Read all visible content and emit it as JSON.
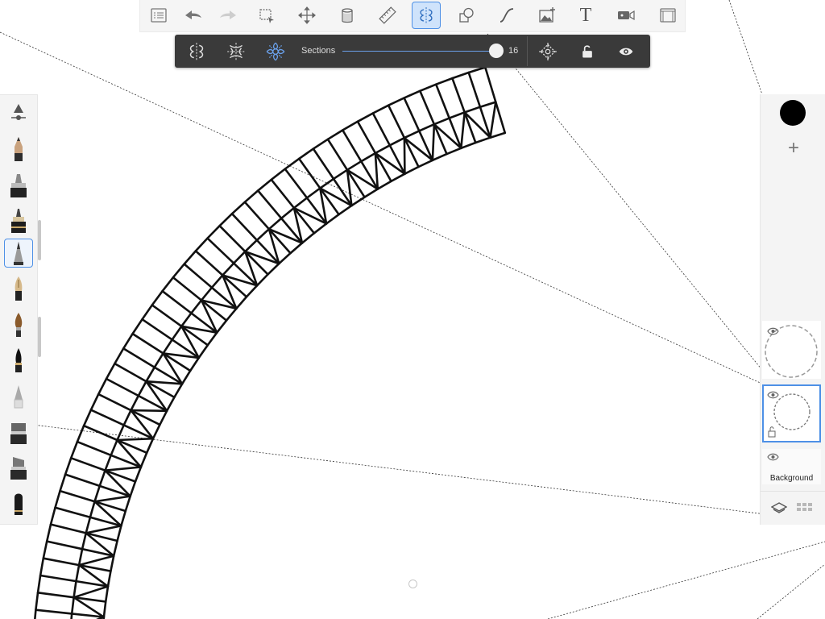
{
  "colors": {
    "accent": "#4d90e6",
    "toolbar_bg": "#f5f5f5",
    "panel_dark": "#3a3a3a",
    "stroke": "#111111",
    "guide": "#333333"
  },
  "top_toolbar": {
    "items": [
      {
        "name": "list",
        "icon": "list-icon",
        "active": false
      },
      {
        "name": "undo",
        "icon": "undo-arrow-icon",
        "active": false
      },
      {
        "name": "redo",
        "icon": "redo-arrow-icon",
        "active": false
      },
      {
        "name": "selection",
        "icon": "selection-icon",
        "active": false
      },
      {
        "name": "transform",
        "icon": "move-arrows-icon",
        "active": false
      },
      {
        "name": "fill",
        "icon": "paint-bucket-icon",
        "active": false
      },
      {
        "name": "ruler",
        "icon": "ruler-icon",
        "active": false
      },
      {
        "name": "symmetry",
        "icon": "symmetry-icon",
        "active": true
      },
      {
        "name": "shapes",
        "icon": "shapes-icon",
        "active": false
      },
      {
        "name": "stroke",
        "icon": "curve-icon",
        "active": false
      },
      {
        "name": "image",
        "icon": "image-icon",
        "active": false
      },
      {
        "name": "text",
        "icon": "text-icon",
        "active": false
      },
      {
        "name": "record",
        "icon": "video-camera-icon",
        "active": false
      },
      {
        "name": "fullscreen",
        "icon": "frame-icon",
        "active": false
      }
    ],
    "text_glyph": "T"
  },
  "symmetry_panel": {
    "modes": [
      "vertical-symmetry-icon",
      "dual-symmetry-icon",
      "radial-symmetry-icon"
    ],
    "active_mode": "radial-symmetry-icon",
    "sections_label": "Sections",
    "sections_value": "16",
    "sections_fraction": 0.98,
    "actions": [
      "center-target-icon",
      "unlock-icon",
      "eye-icon"
    ]
  },
  "brush_palette": {
    "items": [
      "brush-settings-icon",
      "pencil-icon",
      "marker-icon",
      "ink-pen-icon",
      "ballpoint-pen-icon",
      "fountain-pen-icon",
      "paint-brush-icon",
      "ink-brush-icon",
      "airbrush-icon",
      "chisel-marker-icon",
      "wide-marker-icon",
      "eraser-icon"
    ],
    "active_index": 4
  },
  "right_panel": {
    "current_color": "#000000",
    "add_label": "+",
    "layers": [
      {
        "name": "",
        "visible": true,
        "selected": false,
        "thumb": "dashed-circle"
      },
      {
        "name": "",
        "visible": true,
        "selected": true,
        "thumb": "dashed-circle-small",
        "locked_alpha": true
      },
      {
        "name": "Background",
        "visible": true,
        "selected": false,
        "thumb": "blank"
      }
    ],
    "footer": [
      "layers-icon",
      "grid-icon"
    ]
  }
}
